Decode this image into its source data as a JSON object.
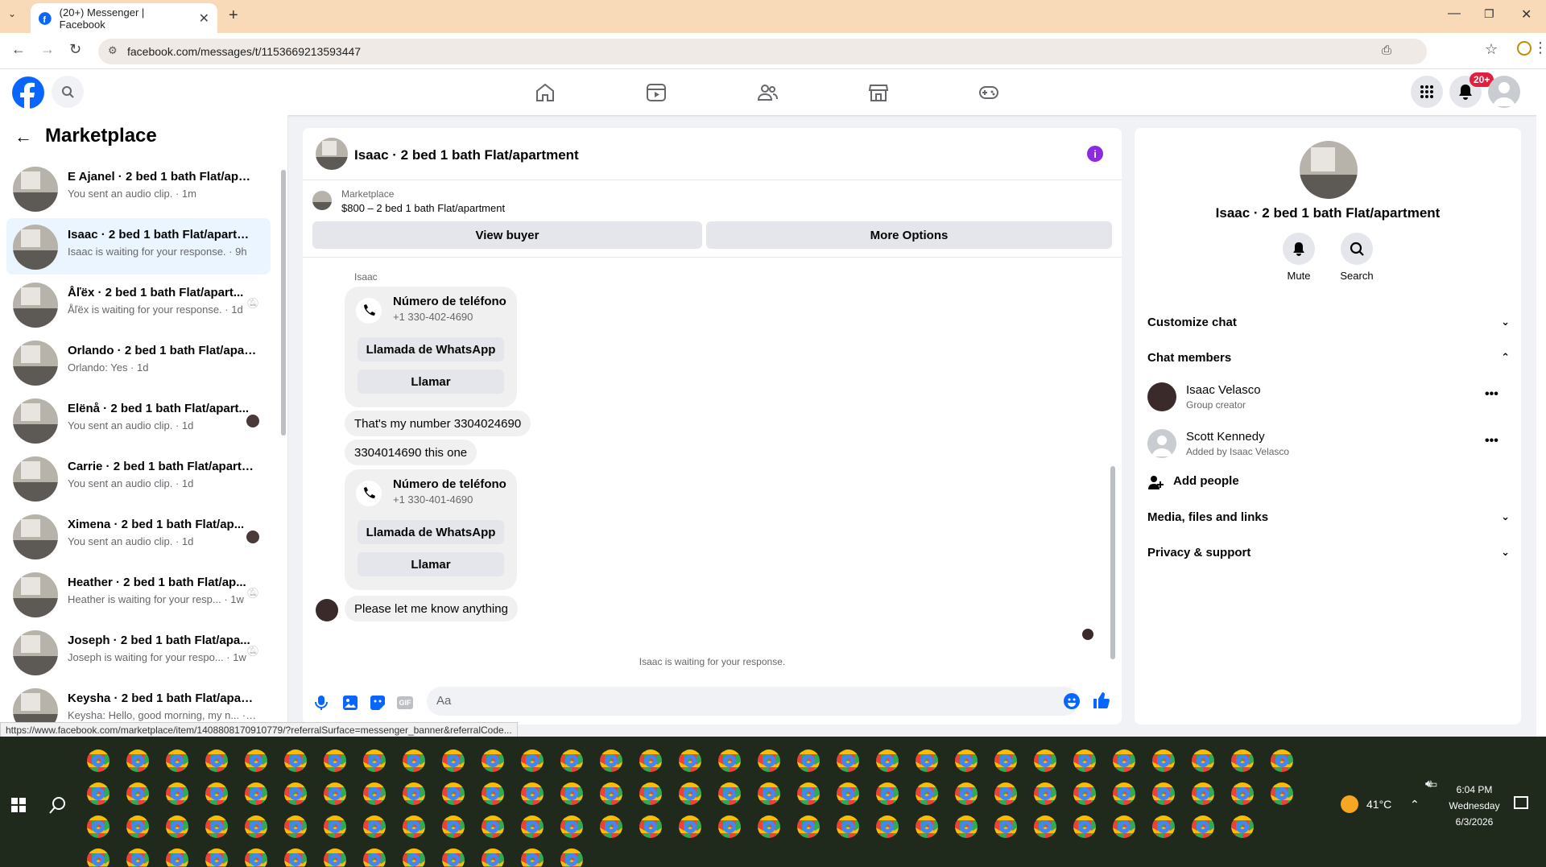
{
  "browser": {
    "tab_title": "(20+) Messenger | Facebook",
    "url": "facebook.com/messages/t/1153669213593447",
    "status_url": "https://www.facebook.com/marketplace/item/1408808170910779/?referralSurface=messenger_banner&referralCode..."
  },
  "header": {
    "notif_badge": "20+"
  },
  "sidebar": {
    "title": "Marketplace",
    "conversations": [
      {
        "name": "E Ajanel · 2 bed 1 bath Flat/apart...",
        "preview": "You sent an audio clip. · 1m"
      },
      {
        "name": "Isaac · 2 bed 1 bath Flat/apartm...",
        "preview": "Isaac is waiting for your response. · 9h"
      },
      {
        "name": "Åľëx · 2 bed 1 bath Flat/apart...",
        "preview": "Åľëx is waiting for your response. · 1d"
      },
      {
        "name": "Orlando · 2 bed 1 bath Flat/apar...",
        "preview": "Orlando: Yes · 1d"
      },
      {
        "name": "Elënå · 2 bed 1 bath Flat/apart...",
        "preview": "You sent an audio clip. · 1d"
      },
      {
        "name": "Carrie · 2 bed 1 bath Flat/apartm...",
        "preview": "You sent an audio clip. · 1d"
      },
      {
        "name": "Ximena · 2 bed 1 bath Flat/ap...",
        "preview": "You sent an audio clip. · 1d"
      },
      {
        "name": "Heather · 2 bed 1 bath Flat/ap...",
        "preview": "Heather is waiting for your resp... · 1w"
      },
      {
        "name": "Joseph · 2 bed 1 bath Flat/apa...",
        "preview": "Joseph is waiting for your respo... · 1w"
      },
      {
        "name": "Keysha · 2 bed 1 bath Flat/apart...",
        "preview": "Keysha: Hello, good morning, my n... · 1w"
      }
    ]
  },
  "chat": {
    "title": "Isaac · 2 bed 1 bath Flat/apartment",
    "listing_source": "Marketplace",
    "listing": "$800 – 2 bed 1 bath Flat/apartment",
    "view_buyer": "View buyer",
    "more_options": "More Options",
    "sender": "Isaac",
    "card1": {
      "title": "Número de teléfono",
      "number": "+1 330-402-4690",
      "btn1": "Llamada de WhatsApp",
      "btn2": "Llamar"
    },
    "msg1": "That's my number 3304024690",
    "msg2": "3304014690 this one",
    "card2": {
      "title": "Número de teléfono",
      "number": "+1 330-401-4690",
      "btn1": "Llamada de WhatsApp",
      "btn2": "Llamar"
    },
    "msg3": "Please let me know anything",
    "waiting": "Isaac is waiting for your response.",
    "composer_placeholder": "Aa"
  },
  "details": {
    "title": "Isaac · 2 bed 1 bath Flat/apartment",
    "mute": "Mute",
    "search": "Search",
    "customize": "Customize chat",
    "members": "Chat members",
    "member1": {
      "name": "Isaac Velasco",
      "role": "Group creator"
    },
    "member2": {
      "name": "Scott Kennedy",
      "role": "Added by Isaac Velasco"
    },
    "add_people": "Add people",
    "media": "Media, files and links",
    "privacy": "Privacy & support"
  },
  "taskbar": {
    "temp": "41°C",
    "time": "6:04 PM",
    "day": "Wednesday",
    "date": "6/3/2026"
  }
}
